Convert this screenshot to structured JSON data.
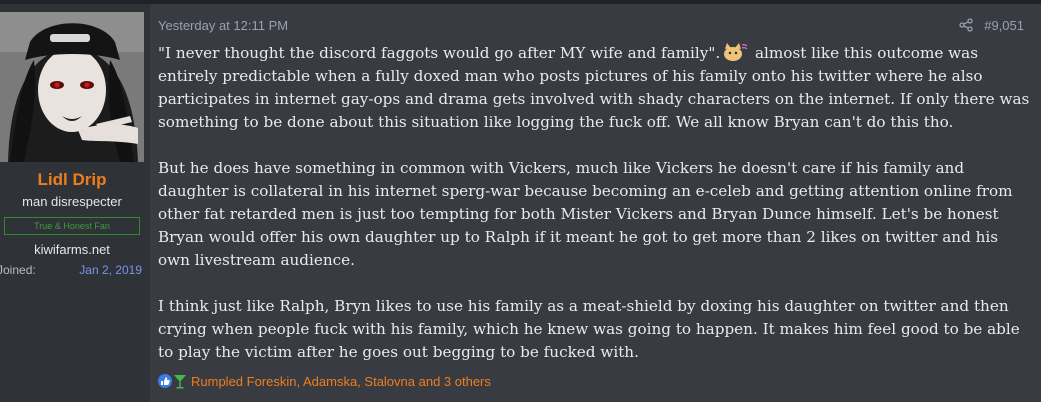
{
  "user": {
    "name": "Lidl Drip",
    "title": "man disrespecter",
    "banner": "True & Honest Fan",
    "site": "kiwifarms.net",
    "joined_label": "Joined:",
    "joined_value": "Jan 2, 2019"
  },
  "post": {
    "timestamp": "Yesterday at 12:11 PM",
    "number": "#9,051",
    "p1_a": "\"I never thought the discord faggots would go after MY wife and family\".",
    "p1_b": " almost like this outcome was entirely predictable when a fully doxed man who posts pictures of his family onto his twitter where he also participates in internet gay-ops and drama gets involved with shady characters on the internet. If only there was something to be done about this situation like logging the fuck off. We all know Bryan can't do this tho.",
    "p2": "But he does have something in common with Vickers, much like Vickers he doesn't care if his family and daughter is collateral in his internet sperg-war because becoming an e-celeb and getting attention online from other fat retarded men is just too tempting for both Mister Vickers and Bryan Dunce himself. Let's be honest Bryan would offer his own daughter up to Ralph if it meant he got to get more than 2 likes on twitter and his own livestream audience.",
    "p3": "I think just like Ralph, Bryn likes to use his family as a meat-shield by doxing his daughter on twitter and then crying when people fuck with his family, which he knew was going to happen. It makes him feel good to be able to play the victim after he goes out begging to be fucked with.",
    "reactions": "Rumpled Foreskin, Adamska, Stalovna and 3 others"
  },
  "colors": {
    "accent": "#f07d1c",
    "post_bg": "#383c42",
    "userbox_bg": "#2f3338",
    "link_blue": "#7a93e8"
  },
  "icons": [
    "share-icon",
    "kitty-emoji-icon",
    "like-reaction-icon",
    "drink-reaction-icon"
  ]
}
